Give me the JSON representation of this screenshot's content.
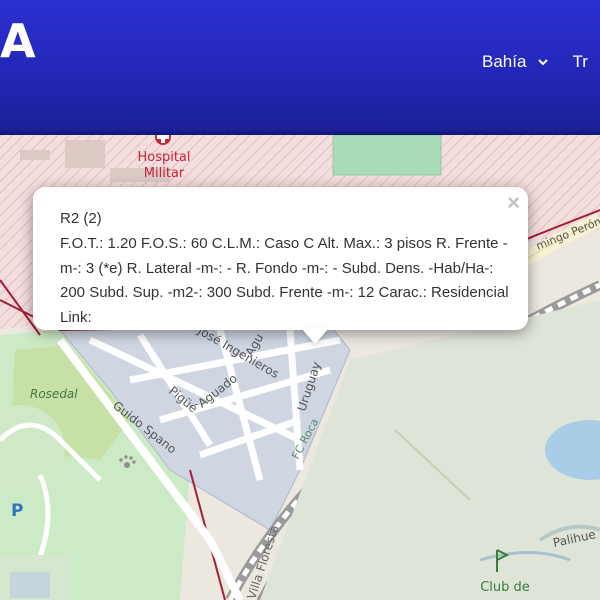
{
  "header": {
    "brand": "A",
    "nav": [
      {
        "label": "Bahía",
        "has_dropdown": true
      },
      {
        "label": "Tr",
        "has_dropdown": false
      }
    ],
    "colors": {
      "bar": "#2328b8",
      "text": "#ffffff"
    }
  },
  "map": {
    "labels": {
      "hospital_line1": "Hospital",
      "hospital_line2": "Militar",
      "rosedal": "Rosedal",
      "guido_spano": "Guido Spano",
      "pigue": "Pigüé",
      "aguado": "Aguado",
      "jose_ingenieros": "José Ingenieros",
      "agua": "Agu",
      "uruguay": "Uruguay",
      "fc_roca": "FC Roca",
      "domingo_peron": "mingo Perón",
      "villa_floresta": "Villa Floresta",
      "palihue": "Palihue",
      "club_de": "Club de",
      "club_partial": "G o lf",
      "parking": "P"
    },
    "zone_color": "#cfd6e2"
  },
  "popup": {
    "close_label": "×",
    "title": "R2 (2)",
    "body": "F.O.T.: 1.20 F.O.S.: 60 C.L.M.: Caso C Alt. Max.: 3 pisos R. Frente -m-: 3 (*e) R. Lateral -m-: - R. Fondo -m-: - Subd. Dens. -Hab/Ha-: 200 Subd. Sup. -m2-: 300 Subd. Frente -m-: 12 Carac.: Residencial Link:"
  }
}
